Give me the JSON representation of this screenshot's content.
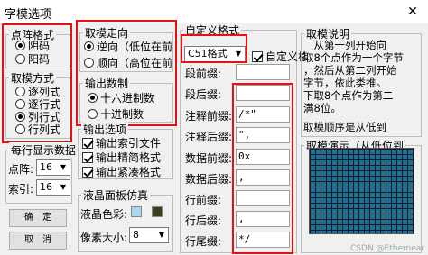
{
  "window": {
    "title": "字模选项",
    "close_glyph": "✕"
  },
  "dot_format": {
    "title": "点阵格式",
    "options": [
      "阴码",
      "阳码"
    ],
    "selected": 0
  },
  "scan_mode": {
    "title": "取模方式",
    "options": [
      "逐列式",
      "逐行式",
      "列行式",
      "行列式"
    ],
    "selected": 2
  },
  "per_line": {
    "title": "每行显示数据",
    "dot_label": "点阵:",
    "dot_value": "16",
    "index_label": "索引:",
    "index_value": "16"
  },
  "buttons": {
    "ok": "确　定",
    "cancel": "取　消"
  },
  "direction": {
    "title": "取模走向",
    "options": [
      "逆向（低位在前",
      "顺向（高位在前"
    ],
    "selected": 0
  },
  "number_system": {
    "title": "输出数制",
    "options": [
      "十六进制数",
      "十进制数"
    ],
    "selected": 0
  },
  "output_options": {
    "title": "输出选项",
    "items": [
      {
        "label": "输出索引文件",
        "checked": true
      },
      {
        "label": "输出精简格式",
        "checked": true
      },
      {
        "label": "输出紧凑格式",
        "checked": true
      }
    ]
  },
  "lcd": {
    "title": "液晶面板仿真",
    "color_label": "液晶色彩:",
    "color_a": "#a9d8ef",
    "color_b": "#36421e",
    "pixel_size_label": "像素大小:",
    "pixel_size_value": "8"
  },
  "custom_format": {
    "title": "自定义格式",
    "format_value": "C51格式",
    "custom_check_label": "自定义格式",
    "custom_checked": true,
    "fields": [
      {
        "label": "段前缀:",
        "value": ""
      },
      {
        "label": "段后缀:",
        "value": ""
      },
      {
        "label": "注释前缀:",
        "value": "/*\""
      },
      {
        "label": "注释后缀:",
        "value": "\","
      },
      {
        "label": "数据前缀:",
        "value": "0x"
      },
      {
        "label": "数据后缀:",
        "value": ","
      },
      {
        "label": "行前缀:",
        "value": ""
      },
      {
        "label": "行后缀:",
        "value": ","
      },
      {
        "label": "行尾缀:",
        "value": "*/"
      }
    ]
  },
  "help": {
    "title": "取模说明",
    "lines": [
      "　从第一列开始向",
      "取8个点作为一个字节",
      "，然后从第二列开始",
      "字节，依此类推。",
      "下取8个点作为第二",
      "满8位。"
    ],
    "order_label": "取模顺序是从低到"
  },
  "demo": {
    "title": "取模演示（从低位到"
  },
  "watermark": "CSDN @Ethernear"
}
